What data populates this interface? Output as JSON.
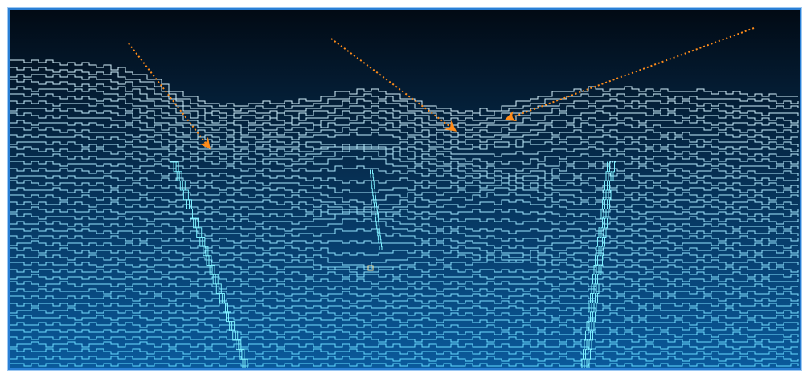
{
  "image": {
    "kind": "stepped contour line rendering with annotation arrows",
    "colors": {
      "frame": "#2a7fd4",
      "background_top": "#020a14",
      "background_bottom": "#0a5a9c",
      "line_top": "#d8f4ff",
      "line_bottom": "#5fd8ff",
      "vertical_seam": "#7ff0ff",
      "arrow": "#ff8c1a"
    },
    "arrows": [
      {
        "name": "arrow-left"
      },
      {
        "name": "arrow-middle"
      },
      {
        "name": "arrow-right"
      }
    ]
  }
}
